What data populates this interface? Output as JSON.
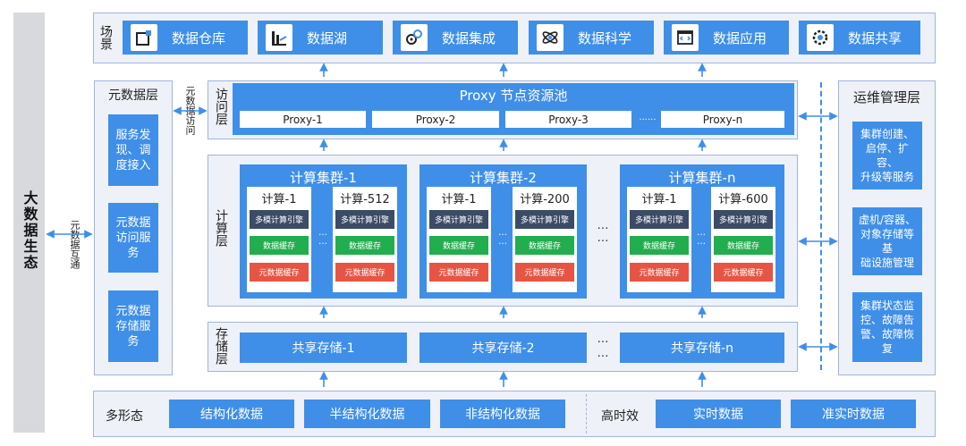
{
  "ecosystem": {
    "label": "大数据生态"
  },
  "meta_interop": {
    "label": "元数据互通"
  },
  "scene": {
    "label": "场景",
    "items": [
      {
        "label": "数据仓库",
        "icon": "warehouse-icon"
      },
      {
        "label": "数据湖",
        "icon": "lake-chart-icon"
      },
      {
        "label": "数据集成",
        "icon": "gears-icon"
      },
      {
        "label": "数据科学",
        "icon": "atom-icon"
      },
      {
        "label": "数据应用",
        "icon": "code-window-icon"
      },
      {
        "label": "数据共享",
        "icon": "share-gear-icon"
      }
    ]
  },
  "metadata_layer": {
    "title": "元数据层",
    "items": [
      {
        "line1": "服务发",
        "line2": "现、调",
        "line3": "度接入"
      },
      {
        "line1": "元数据",
        "line2": "访问服",
        "line3": "务"
      },
      {
        "line1": "元数据",
        "line2": "存储服",
        "line3": "务"
      }
    ]
  },
  "meta_access": {
    "label": "元数据访问"
  },
  "access_layer": {
    "label": "访问层",
    "pool_title": "Proxy 节点资源池",
    "proxies": [
      "Proxy-1",
      "Proxy-2",
      "Proxy-3",
      "Proxy-n"
    ],
    "ellipsis": "......"
  },
  "compute_layer": {
    "label": "计算层",
    "engine_label": "多模计算引擎",
    "data_cache_label": "数据缓存",
    "meta_cache_label": "元数据缓存",
    "ellipsis": "…",
    "clusters": [
      {
        "title": "计算集群-1",
        "first_node": "计算-1",
        "last_node": "计算-512"
      },
      {
        "title": "计算集群-2",
        "first_node": "计算-1",
        "last_node": "计算-200"
      },
      {
        "title": "计算集群-n",
        "first_node": "计算-1",
        "last_node": "计算-600"
      }
    ]
  },
  "storage_layer": {
    "label": "存储层",
    "items": [
      "共享存储-1",
      "共享存储-2",
      "共享存储-n"
    ],
    "ellipsis": "…"
  },
  "ops_layer": {
    "title": "运维管理层",
    "items": [
      {
        "line1": "集群创建、",
        "line2": "启停、扩容、",
        "line3": "升级等服务",
        "line4": ""
      },
      {
        "line1": "虚机/容器、",
        "line2": "对象存储等基",
        "line3": "础设施管理",
        "line4": ""
      },
      {
        "line1": "集群状态监",
        "line2": "控、故障告",
        "line3": "警、故障恢",
        "line4": "复"
      }
    ]
  },
  "bottom": {
    "multi_form_label": "多形态",
    "multi_form_items": [
      "结构化数据",
      "半结构化数据",
      "非结构化数据"
    ],
    "realtime_label": "高时效",
    "realtime_items": [
      "实时数据",
      "准实时数据"
    ]
  }
}
